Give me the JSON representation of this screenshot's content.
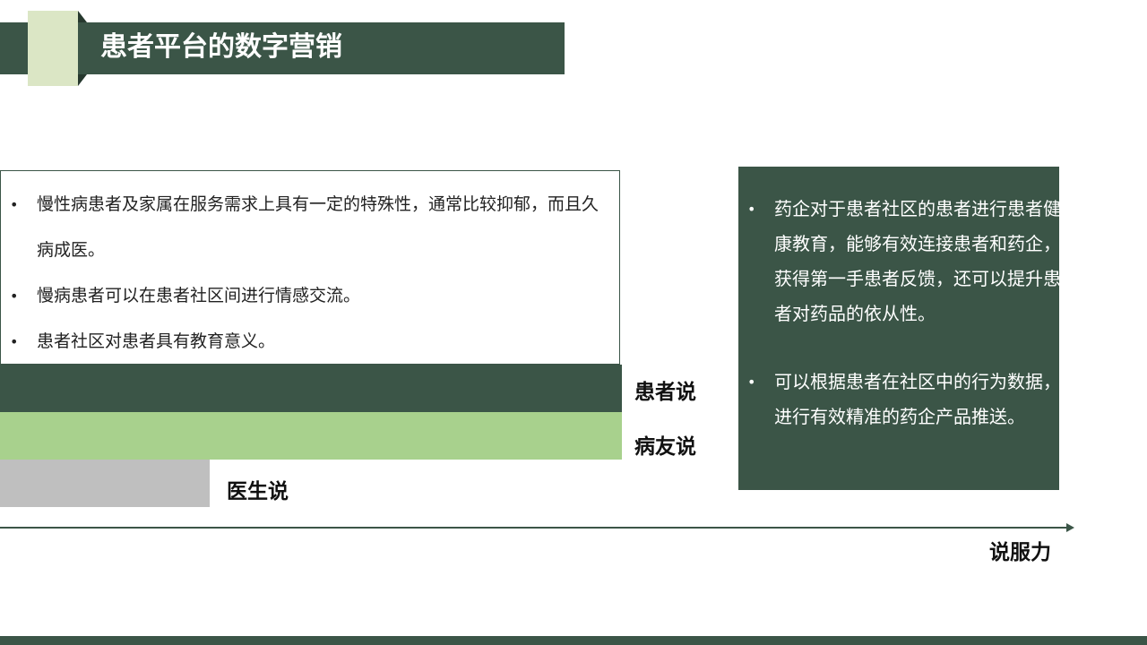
{
  "title": "患者平台的数字营销",
  "left_box": {
    "items": [
      "慢性病患者及家属在服务需求上具有一定的特殊性，通常比较抑郁，而且久病成医。",
      "慢病患者可以在患者社区间进行情感交流。",
      "患者社区对患者具有教育意义。"
    ]
  },
  "bars": {
    "patient_label": "患者说",
    "peer_label": "病友说",
    "doctor_label": "医生说"
  },
  "axis_label": "说服力",
  "right_box": {
    "items": [
      "药企对于患者社区的患者进行患者健康教育，能够有效连接患者和药企，获得第一手患者反馈，还可以提升患者对药品的依从性。",
      "可以根据患者在社区中的行为数据，进行有效精准的药企产品推送。"
    ]
  },
  "colors": {
    "dark_green": "#3b5547",
    "light_green": "#a8d18d",
    "gray": "#bfbfbf",
    "accent": "#dbe6c5"
  }
}
